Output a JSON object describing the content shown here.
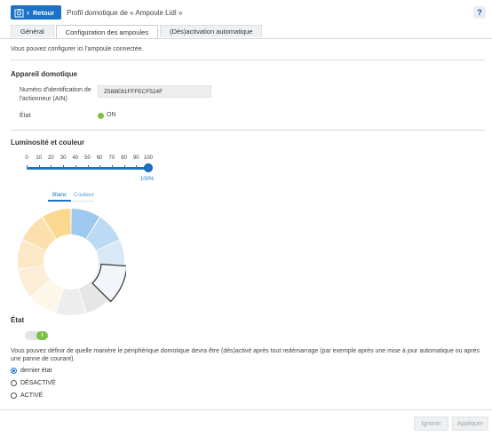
{
  "header": {
    "back_label": "Retour",
    "title": "Profil domotique de « Ampoule Lidl »",
    "help_label": "?"
  },
  "tabs": [
    {
      "label": "Général"
    },
    {
      "label": "Configuration des ampoules"
    },
    {
      "label": "(Dés)activation automatique"
    }
  ],
  "intro": "Vous pouvez configurer ici l'ampoule connectée.",
  "device": {
    "section_title": "Appareil domotique",
    "ain_label": "Numéro d'identification de l'actionneur (AIN)",
    "ain_value": "Z588E81FFFECF524F",
    "state_label": "État",
    "state_value": "ON"
  },
  "brightness": {
    "section_title": "Luminosité et couleur",
    "ticks": [
      "0",
      "10",
      "20",
      "30",
      "40",
      "50",
      "60",
      "70",
      "80",
      "90",
      "100"
    ],
    "value_percent": 100,
    "value_label": "100%"
  },
  "color_tabs": {
    "white": "Blanc",
    "color": "Couleur"
  },
  "color_wheel": {
    "segments": [
      "#9ec8ee",
      "#bcdaf3",
      "#d8e8f6",
      "#eef3f8",
      "#e6e6e6",
      "#ededed",
      "#fdf7ea",
      "#fceed6",
      "#fce8c5",
      "#fbe0ae",
      "#fad88f"
    ],
    "selected_index": 3
  },
  "restart": {
    "section_title": "État",
    "toggle_label": "I",
    "description": "Vous pouvez définir de quelle manière le périphérique domotique devra être (dés)activé après tout redémarrage (par exemple après une mise à jour automatique ou après une panne de courant).",
    "options": [
      {
        "label": "dernier état",
        "checked": true
      },
      {
        "label": "DÉSACTIVÉ",
        "checked": false
      },
      {
        "label": "ACTIVÉ",
        "checked": false
      }
    ]
  },
  "footer": {
    "ignore_label": "Ignorer",
    "apply_label": "Appliquer"
  }
}
